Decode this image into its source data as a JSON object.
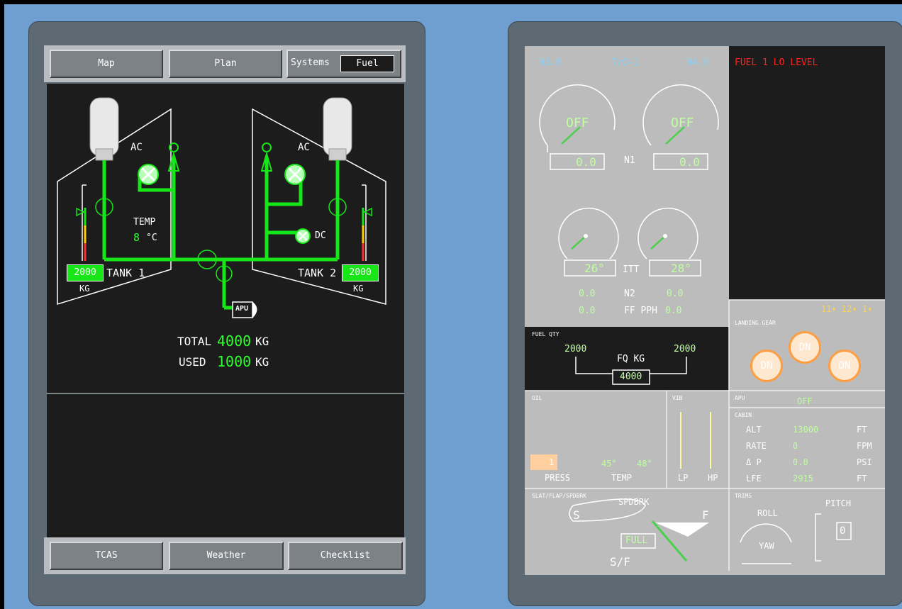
{
  "left": {
    "tabs": {
      "map": "Map",
      "plan": "Plan",
      "systems": "Systems",
      "fuel": "Fuel"
    },
    "bottom_tabs": {
      "tcas": "TCAS",
      "weather": "Weather",
      "checklist": "Checklist"
    },
    "fuel_page": {
      "tank1": {
        "label": "TANK 1",
        "qty": "2000",
        "unit": "KG"
      },
      "tank2": {
        "label": "TANK 2",
        "qty": "2000",
        "unit": "KG"
      },
      "ac1": "AC",
      "ac2": "AC",
      "dc": "DC",
      "temp_label": "TEMP",
      "temp_value": "8",
      "temp_unit": "°C",
      "apu": "APU",
      "total_label": "TOTAL",
      "total_value": "4000",
      "total_unit": "KG",
      "used_label": "USED",
      "used_value": "1000",
      "used_unit": "KG"
    }
  },
  "eicas": {
    "n1_left": "93.8",
    "mode": "T/O-1",
    "n1_right": "94.0",
    "n1_off_left": "OFF",
    "n1_off_right": "OFF",
    "n1_val_left": "0.0",
    "n1_val_right": "0.0",
    "n1_label": "N1",
    "itt_left": "26°",
    "itt_right": "28°",
    "itt_label": "ITT",
    "n2_left": "0.0",
    "n2_label": "N2",
    "n2_right": "0.0",
    "ff_left": "0.0",
    "ff_label": "FF PPH",
    "ff_right": "0.0",
    "cas_message": "FUEL 1 LO LEVEL",
    "cas_counts": "11▾ 12▾ 1▾",
    "fuel_qty_title": "FUEL QTY",
    "fq_left": "2000",
    "fq_right": "2000",
    "fq_label": "FQ KG",
    "fq_total": "4000",
    "landing_gear_title": "LANDING GEAR",
    "gear_nose": "DN",
    "gear_left": "DN",
    "gear_right": "DN",
    "oil_title": "OIL",
    "oil_press_val": "1",
    "oil_press_label": "PRESS",
    "oil_temp_left": "45°",
    "oil_temp_right": "48°",
    "oil_temp_label": "TEMP",
    "vib_title": "VIB",
    "lp_label": "LP",
    "hp_label": "HP",
    "apu_title": "APU",
    "apu_status": "OFF",
    "cabin_title": "CABIN",
    "cabin_rows": [
      {
        "label": "ALT",
        "value": "13000",
        "unit": "FT"
      },
      {
        "label": "RATE",
        "value": "0",
        "unit": "FPM"
      },
      {
        "label": "Δ P",
        "value": "0.0",
        "unit": "PSI"
      },
      {
        "label": "LFE",
        "value": "2915",
        "unit": "FT"
      }
    ],
    "slat_title": "SLAT/FLAP/SPDBRK",
    "spdbrk_label": "SPDBRK",
    "s_label": "S",
    "f_label": "F",
    "full_label": "FULL",
    "sf_label": "S/F",
    "trims_title": "TRIMS",
    "roll_label": "ROLL",
    "yaw_label": "YAW",
    "pitch_label": "PITCH",
    "pitch_value": "0"
  }
}
